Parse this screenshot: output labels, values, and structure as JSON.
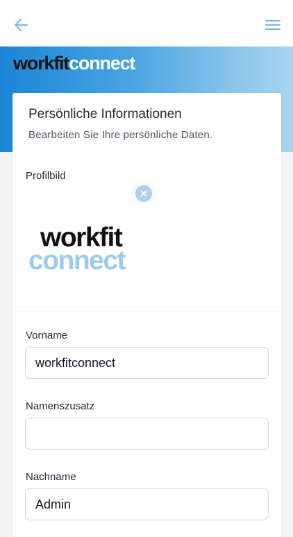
{
  "header": {
    "back_icon": "arrow-left-icon",
    "menu_icon": "hamburger-menu-icon",
    "icon_color": "#7fb8e6"
  },
  "brand": {
    "part1": "workfit",
    "part2": "connect"
  },
  "colors": {
    "gradient_start": "#1b86d6",
    "gradient_end": "#a8d3ee",
    "remove_button": "#a9d1ee",
    "logo_light": "#9ccbee"
  },
  "section": {
    "title": "Persönliche Informationen",
    "subtitle": "Bearbeiten Sie Ihre persönliche Daten."
  },
  "profile_picture": {
    "label": "Profilbild",
    "remove_icon": "close-icon",
    "logo_line1": "workfit",
    "logo_line2": "connect"
  },
  "fields": {
    "first_name": {
      "label": "Vorname",
      "value": "workfitconnect"
    },
    "name_suffix": {
      "label": "Namenszusatz",
      "value": ""
    },
    "last_name": {
      "label": "Nachname",
      "value": "Admin"
    }
  }
}
